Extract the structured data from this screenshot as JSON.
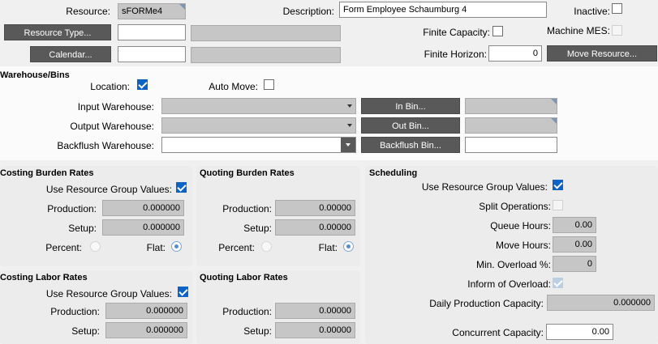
{
  "top": {
    "resource_label": "Resource:",
    "resource_value": "sFORMe4",
    "description_label": "Description:",
    "description_value": "Form Employee Schaumburg 4",
    "inactive_label": "Inactive:",
    "resource_type_button": "Resource Type...",
    "calendar_button": "Calendar...",
    "finite_capacity_label": "Finite Capacity:",
    "machine_mes_label": "Machine MES:",
    "finite_horizon_label": "Finite Horizon:",
    "finite_horizon_value": "0",
    "move_resource_button": "Move Resource..."
  },
  "warehouse": {
    "title": "Warehouse/Bins",
    "location_label": "Location:",
    "auto_move_label": "Auto Move:",
    "input_warehouse_label": "Input Warehouse:",
    "output_warehouse_label": "Output Warehouse:",
    "backflush_warehouse_label": "Backflush Warehouse:",
    "in_bin_button": "In Bin...",
    "out_bin_button": "Out Bin...",
    "backflush_bin_button": "Backflush Bin..."
  },
  "costing_burden": {
    "title": "Costing Burden Rates",
    "use_group_label": "Use Resource Group Values:",
    "production_label": "Production:",
    "production_value": "0.000000",
    "setup_label": "Setup:",
    "setup_value": "0.000000",
    "percent_label": "Percent:",
    "flat_label": "Flat:"
  },
  "quoting_burden": {
    "title": "Quoting Burden Rates",
    "production_label": "Production:",
    "production_value": "0.00000",
    "setup_label": "Setup:",
    "setup_value": "0.00000",
    "percent_label": "Percent:",
    "flat_label": "Flat:"
  },
  "costing_labor": {
    "title": "Costing Labor Rates",
    "use_group_label": "Use Resource Group Values:",
    "production_label": "Production:",
    "production_value": "0.000000",
    "setup_label": "Setup:",
    "setup_value": "0.000000"
  },
  "quoting_labor": {
    "title": "Quoting Labor Rates",
    "production_label": "Production:",
    "production_value": "0.00000",
    "setup_label": "Setup:",
    "setup_value": "0.00000"
  },
  "scheduling": {
    "title": "Scheduling",
    "use_group_label": "Use Resource Group Values:",
    "split_operations_label": "Split Operations:",
    "queue_hours_label": "Queue Hours:",
    "queue_hours_value": "0.00",
    "move_hours_label": "Move Hours:",
    "move_hours_value": "0.00",
    "min_overload_label": "Min. Overload %:",
    "min_overload_value": "0",
    "inform_overload_label": "Inform of Overload:",
    "daily_capacity_label": "Daily Production Capacity:",
    "daily_capacity_value": "0.000000",
    "concurrent_capacity_label": "Concurrent Capacity:",
    "concurrent_capacity_value": "0.00"
  }
}
